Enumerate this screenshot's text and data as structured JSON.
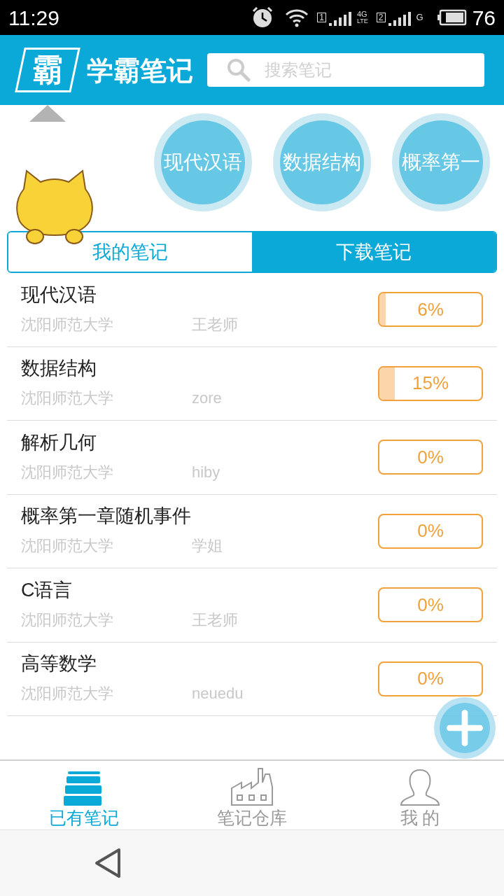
{
  "status_bar": {
    "time": "11:29",
    "sim1": "1",
    "net1": "4G",
    "net1_sub": "LTE",
    "sim2": "2",
    "net2": "G",
    "battery": "76"
  },
  "header": {
    "logo_glyph": "霸",
    "app_name": "学霸笔记",
    "search": {
      "placeholder": "搜索笔记"
    }
  },
  "carousel": [
    {
      "label": "现代汉语"
    },
    {
      "label": "数据结构"
    },
    {
      "label": "概率第一"
    }
  ],
  "tabs": [
    {
      "label": "我的笔记",
      "selected": true
    },
    {
      "label": "下载笔记",
      "selected": false
    }
  ],
  "notes": [
    {
      "title": "现代汉语",
      "school": "沈阳师范大学",
      "author": "王老师",
      "progress": "6%",
      "level": 0.06
    },
    {
      "title": "数据结构",
      "school": "沈阳师范大学",
      "author": "zore",
      "progress": "15%",
      "level": 0.15
    },
    {
      "title": "解析几何",
      "school": "沈阳师范大学",
      "author": "hiby",
      "progress": "0%"
    },
    {
      "title": "概率第一章随机事件",
      "school": "沈阳师范大学",
      "author": "学姐",
      "progress": "0%"
    },
    {
      "title": "C语言",
      "school": "沈阳师范大学",
      "author": "王老师",
      "progress": "0%"
    },
    {
      "title": "高等数学",
      "school": "沈阳师范大学",
      "author": "neuedu",
      "progress": "0%"
    }
  ],
  "bottom_nav": [
    {
      "label": "已有笔记",
      "kind": "books",
      "selected": true
    },
    {
      "label": "笔记仓库",
      "kind": "factory",
      "selected": false
    },
    {
      "label": "我 的",
      "kind": "person",
      "selected": false
    }
  ]
}
